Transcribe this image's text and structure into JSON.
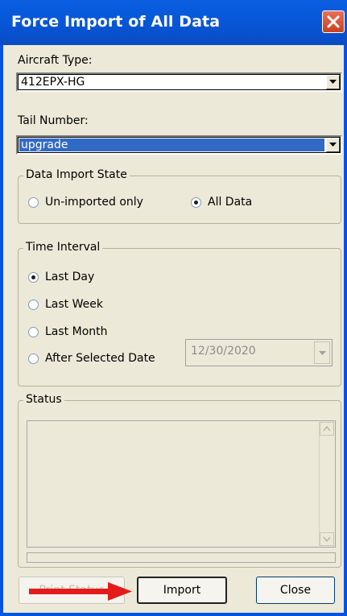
{
  "window": {
    "title": "Force Import of All Data"
  },
  "aircraft": {
    "label": "Aircraft Type:",
    "value": "412EPX-HG"
  },
  "tail": {
    "label": "Tail Number:",
    "value": "upgrade"
  },
  "import_state": {
    "title": "Data Import State",
    "options": [
      "Un-imported only",
      "All Data"
    ],
    "selected": "All Data"
  },
  "time_interval": {
    "title": "Time Interval",
    "options": [
      "Last Day",
      "Last Week",
      "Last Month",
      "After Selected Date"
    ],
    "selected": "Last Day",
    "date": "12/30/2020"
  },
  "status": {
    "title": "Status",
    "text": ""
  },
  "buttons": {
    "print_status": "Print Status",
    "import": "Import",
    "close": "Close"
  },
  "colors": {
    "title_bar": "#0a5fe0",
    "dialog_bg": "#ece9d8",
    "selection": "#316ac5",
    "annotation_arrow": "#e41b1b"
  }
}
